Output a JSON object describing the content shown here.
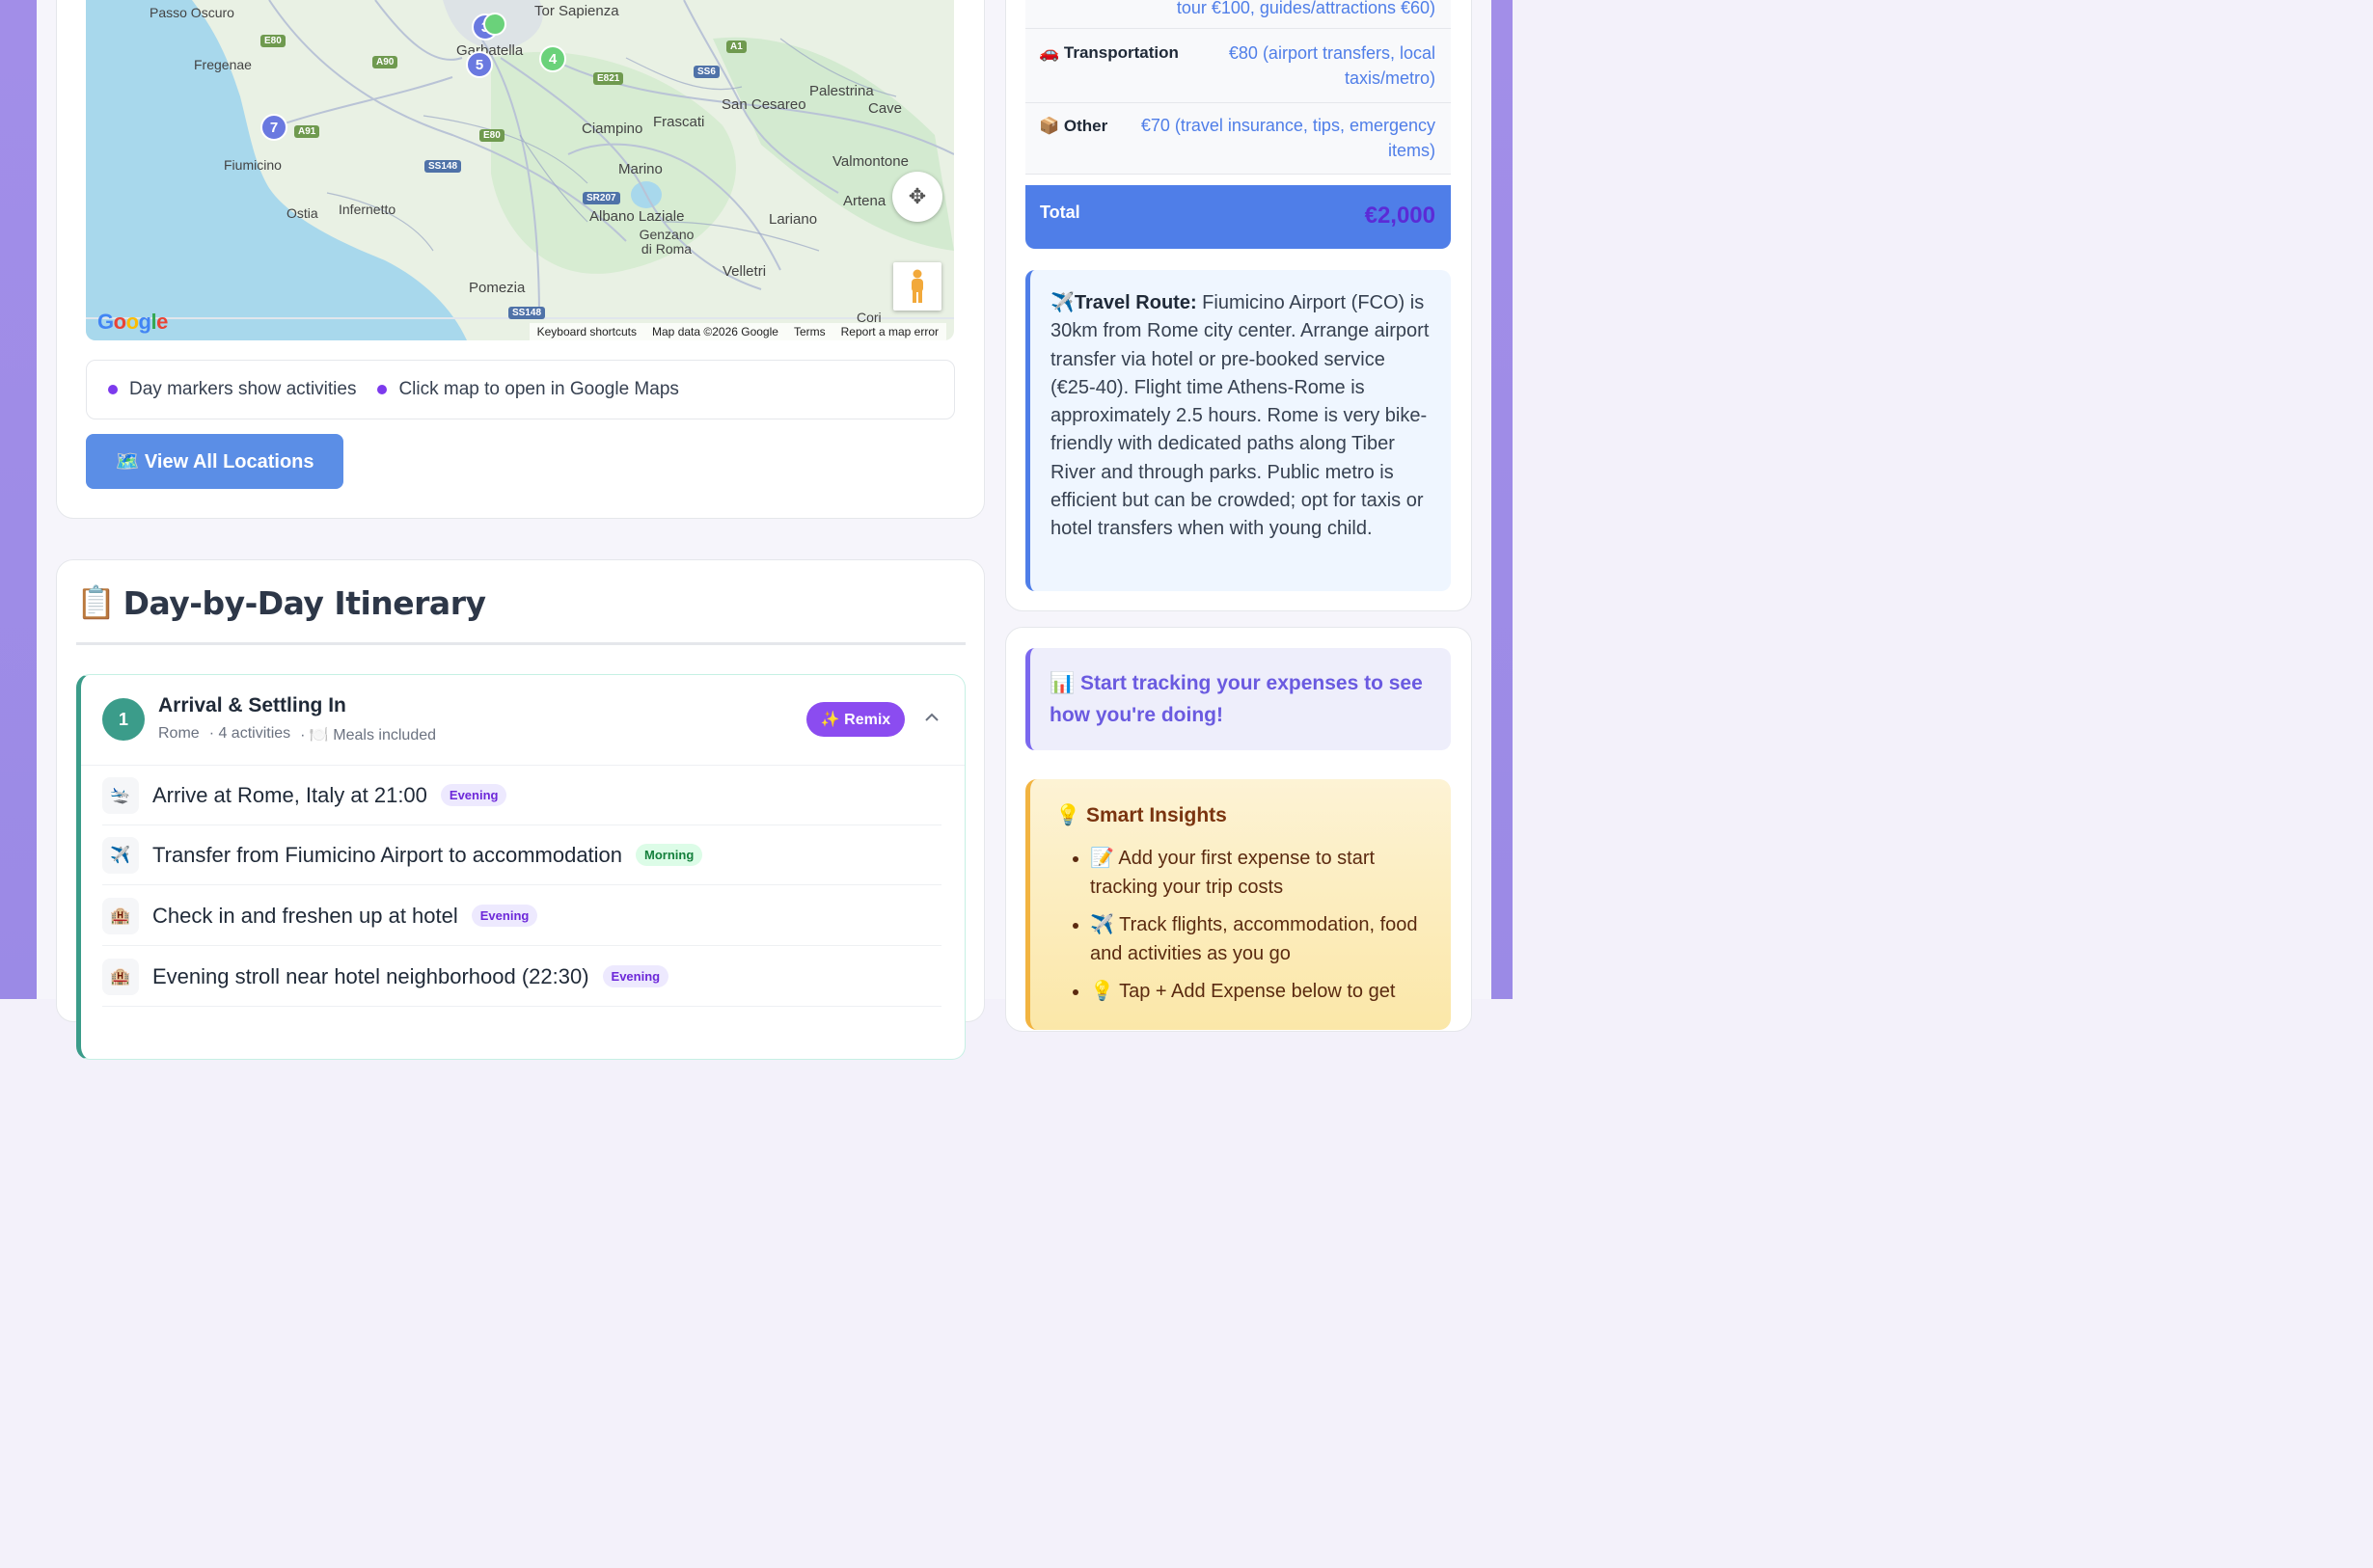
{
  "map": {
    "places": [
      "Passo Oscuro",
      "Tor Sapienza",
      "Fregenae",
      "Fiumicino",
      "Ostia",
      "Infernetto",
      "Ciampino",
      "Frascati",
      "San Cesareo",
      "Palestrina",
      "Cave",
      "Marino",
      "Valmontone",
      "Artena",
      "Albano Laziale",
      "Genzano di Roma",
      "Lariano",
      "Velletri",
      "Pomezia",
      "Cori",
      "Garbatella"
    ],
    "roads": [
      "E80",
      "A90",
      "A1",
      "SS6",
      "E821",
      "A91",
      "E80",
      "SS148",
      "SR207",
      "SS148"
    ],
    "markers": [
      "3",
      "5",
      "4",
      "7",
      "2"
    ],
    "logo": "Google",
    "footer": {
      "shortcuts": "Keyboard shortcuts",
      "data": "Map data ©2026 Google",
      "terms": "Terms",
      "report": "Report a map error"
    }
  },
  "legend": {
    "item1": "Day markers show activities",
    "item2": "Click map to open in Google Maps"
  },
  "view_all_button": "🗺️ View All Locations",
  "itinerary": {
    "title_icon": "📋",
    "title": "Day-by-Day Itinerary",
    "day": {
      "number": "1",
      "name": "Arrival & Settling In",
      "city": "Rome",
      "activities_count": "· 4 activities",
      "meals": "· 🍽️ Meals included",
      "remix_label": "✨ Remix"
    },
    "activities": [
      {
        "icon": "🛬",
        "text": "Arrive at Rome, Italy at 21:00",
        "badge": "Evening",
        "badge_type": "evening"
      },
      {
        "icon": "✈️",
        "text": "Transfer from Fiumicino Airport to accommodation",
        "badge": "Morning",
        "badge_type": "morning"
      },
      {
        "icon": "🏨",
        "text": "Check in and freshen up at hotel",
        "badge": "Evening",
        "badge_type": "evening"
      },
      {
        "icon": "🏨",
        "text": "Evening stroll near hotel neighborhood (22:30)",
        "badge": "Evening",
        "badge_type": "evening"
      }
    ]
  },
  "budget": {
    "partial_top": "tour €100, guides/attractions €60)",
    "transportation": {
      "label": "🚗 Transportation",
      "value": "€80 (airport transfers, local taxis/metro)"
    },
    "other": {
      "label": "📦 Other",
      "value": "€70 (travel insurance, tips, emergency items)"
    },
    "total_label": "Total",
    "total_value": "€2,000"
  },
  "route": {
    "icon": "✈️",
    "heading": "Travel Route:",
    "text": " Fiumicino Airport (FCO) is 30km from Rome city center. Arrange airport transfer via hotel or pre-booked service (€25-40). Flight time Athens-Rome is approximately 2.5 hours. Rome is very bike-friendly with dedicated paths along Tiber River and through parks. Public metro is efficient but can be crowded; opt for taxis or hotel transfers when with young child."
  },
  "tracking": {
    "text": "📊 Start tracking your expenses to see how you're doing!"
  },
  "insights": {
    "title": "💡 Smart Insights",
    "items": [
      "📝 Add your first expense to start tracking your trip costs",
      "✈️ Track flights, accommodation, food and activities as you go",
      "💡 Tap + Add Expense below to get"
    ]
  },
  "colors": {
    "accent_purple": "#8b4cf0",
    "accent_blue": "#4f7ee8",
    "teal": "#3b9c8a"
  }
}
